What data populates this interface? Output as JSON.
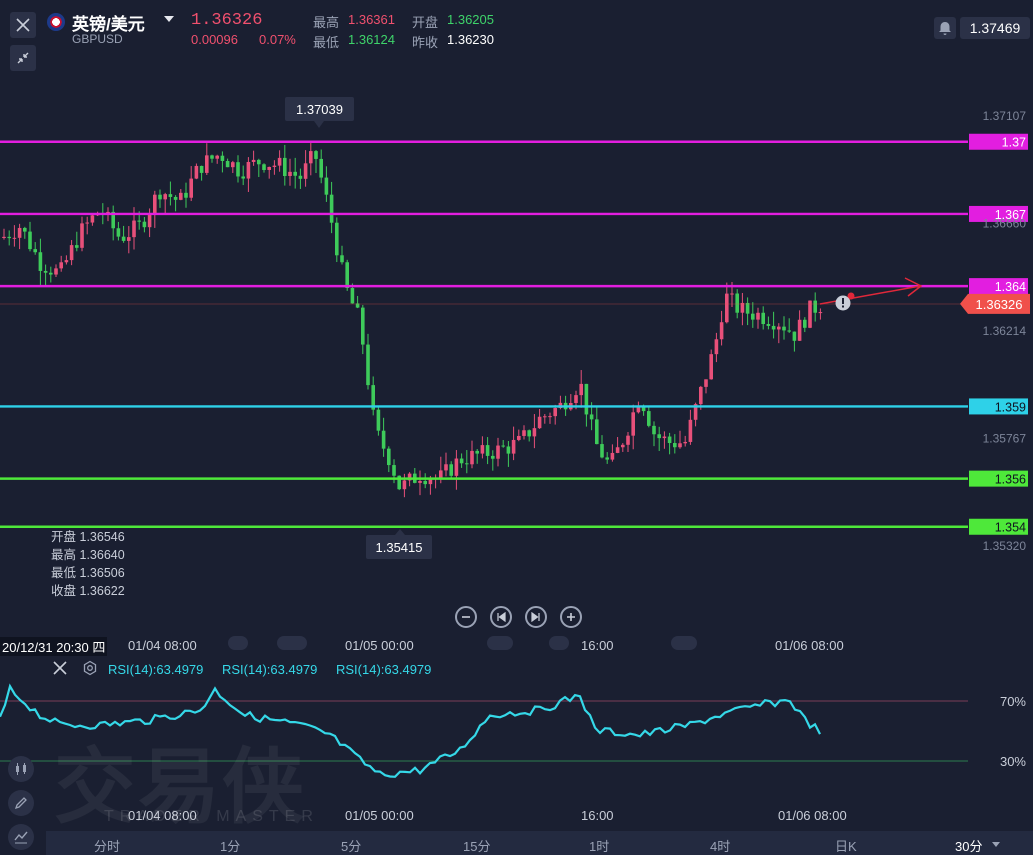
{
  "header": {
    "pair_name": "英镑/美元",
    "pair_code": "GBPUSD",
    "last_price": "1.36326",
    "change": "0.00096",
    "change_pct": "0.07%",
    "high_label": "最高",
    "high_value": "1.36361",
    "open_label": "开盘",
    "open_value": "1.36205",
    "low_label": "最低",
    "low_value": "1.36124",
    "prev_close_label": "昨收",
    "prev_close_value": "1.36230",
    "top_right_price": "1.37469",
    "icons": {
      "close": "close-icon",
      "shrink": "shrink-icon",
      "bell": "bell-icon",
      "flag": "uk-flag-icon"
    }
  },
  "price_axis": {
    "ticks": [
      "1.37107",
      "1.36660",
      "1.36214",
      "1.35767",
      "1.35320"
    ],
    "current_price": "1.36326",
    "current_price_color": "#f0504b"
  },
  "levels": [
    {
      "label": "1.37",
      "color": "#e21ee0",
      "price": 1.37
    },
    {
      "label": "1.367",
      "color": "#e21ee0",
      "price": 1.367
    },
    {
      "label": "1.364",
      "color": "#e21ee0",
      "price": 1.364
    },
    {
      "label": "1.359",
      "color": "#2ed1e8",
      "price": 1.359
    },
    {
      "label": "1.356",
      "color": "#4ee83a",
      "price": 1.356
    },
    {
      "label": "1.354",
      "color": "#4ee83a",
      "price": 1.354
    }
  ],
  "annotations": {
    "high_marker": "1.37039",
    "low_marker": "1.35415"
  },
  "ohlc_panel": [
    {
      "label": "开盘",
      "value": "1.36546"
    },
    {
      "label": "最高",
      "value": "1.36640"
    },
    {
      "label": "最低",
      "value": "1.36506"
    },
    {
      "label": "收盘",
      "value": "1.36622"
    }
  ],
  "time_axis": {
    "crosshair_label": "20/12/31 20:30 四",
    "labels": [
      "01/04 08:00",
      "01/05 00:00",
      "16:00",
      "01/06 08:00"
    ]
  },
  "rsi": {
    "labels": [
      "RSI(14):63.4979",
      "RSI(14):63.4979",
      "RSI(14):63.4979"
    ],
    "level_high": "70%",
    "level_low": "30%",
    "time_labels": [
      "01/04 08:00",
      "01/05 00:00",
      "16:00",
      "01/06 08:00"
    ]
  },
  "watermark": {
    "cn": "交易侠",
    "en": "TRADER MASTER"
  },
  "periods": [
    {
      "label": "分时",
      "active": false
    },
    {
      "label": "1分",
      "active": false
    },
    {
      "label": "5分",
      "active": false
    },
    {
      "label": "15分",
      "active": false
    },
    {
      "label": "1时",
      "active": false
    },
    {
      "label": "4时",
      "active": false
    },
    {
      "label": "日K",
      "active": false
    },
    {
      "label": "30分",
      "active": true
    }
  ],
  "chart_data": {
    "type": "candlestick",
    "interval": "30分",
    "y_axis_ticks": [
      1.37107,
      1.3666,
      1.36214,
      1.35767,
      1.3532
    ],
    "visible_high": 1.37039,
    "visible_low": 1.35415,
    "last_close": 1.36326
  }
}
